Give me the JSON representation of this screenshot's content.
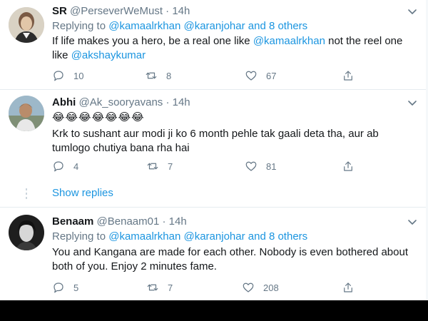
{
  "tweets": [
    {
      "name": "SR",
      "handle": "@PerseverWeMust",
      "dot": "·",
      "time": "14h",
      "replying_prefix": "Replying to",
      "replying_handles": "@kamaalrkhan @karanjohar",
      "replying_suffix": "and 8 others",
      "text_1": "If life makes you a hero, be a real one like",
      "mention_1": "@kamaalrkhan",
      "text_2": "not the reel one",
      "text_3": "like",
      "mention_2": "@akshaykumar",
      "replies": "10",
      "retweets": "8",
      "likes": "67"
    },
    {
      "name": "Abhi",
      "handle": "@Ak_sooryavans",
      "dot": "·",
      "time": "14h",
      "emojis": "😂😂😂😂😂😂😂",
      "text_line1": "Krk to sushant aur modi ji ko 6 month pehle tak gaali deta tha, aur ab",
      "text_line2": "tumlogo chutiya bana rha hai",
      "replies": "4",
      "retweets": "7",
      "likes": "81"
    },
    {
      "name": "Benaam",
      "handle": "@Benaam01",
      "dot": "·",
      "time": "14h",
      "replying_prefix": "Replying to",
      "replying_handles": "@kamaalrkhan @karanjohar",
      "replying_suffix": "and 8 others",
      "text_line1": "You and Kangana are made for each other. Nobody is even bothered about",
      "text_line2": "both of you. Enjoy 2 minutes fame.",
      "replies": "5",
      "retweets": "7",
      "likes": "208"
    }
  ],
  "show_replies": "Show replies",
  "icons": {
    "reply": "reply-icon",
    "retweet": "retweet-icon",
    "like": "heart-icon",
    "share": "share-icon",
    "more": "chevron-down-icon"
  },
  "colors": {
    "link": "#1b95e0",
    "muted": "#657786",
    "text": "#14171a",
    "divider": "#e6ecf0"
  }
}
